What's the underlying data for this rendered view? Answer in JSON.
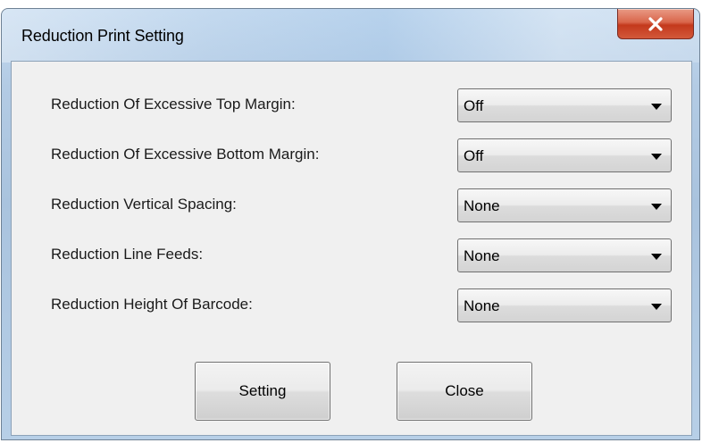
{
  "window": {
    "title": "Reduction Print Setting",
    "close_icon": "close-icon"
  },
  "settings": [
    {
      "label": "Reduction Of Excessive Top Margin:",
      "value": "Off"
    },
    {
      "label": "Reduction Of Excessive Bottom Margin:",
      "value": "Off"
    },
    {
      "label": "Reduction Vertical Spacing:",
      "value": "None"
    },
    {
      "label": "Reduction Line Feeds:",
      "value": "None"
    },
    {
      "label": "Reduction Height Of Barcode:",
      "value": "None"
    }
  ],
  "buttons": {
    "setting_label": "Setting",
    "close_label": "Close"
  },
  "colors": {
    "close_button": "#c4391c",
    "client_background": "#f0f0f0"
  }
}
